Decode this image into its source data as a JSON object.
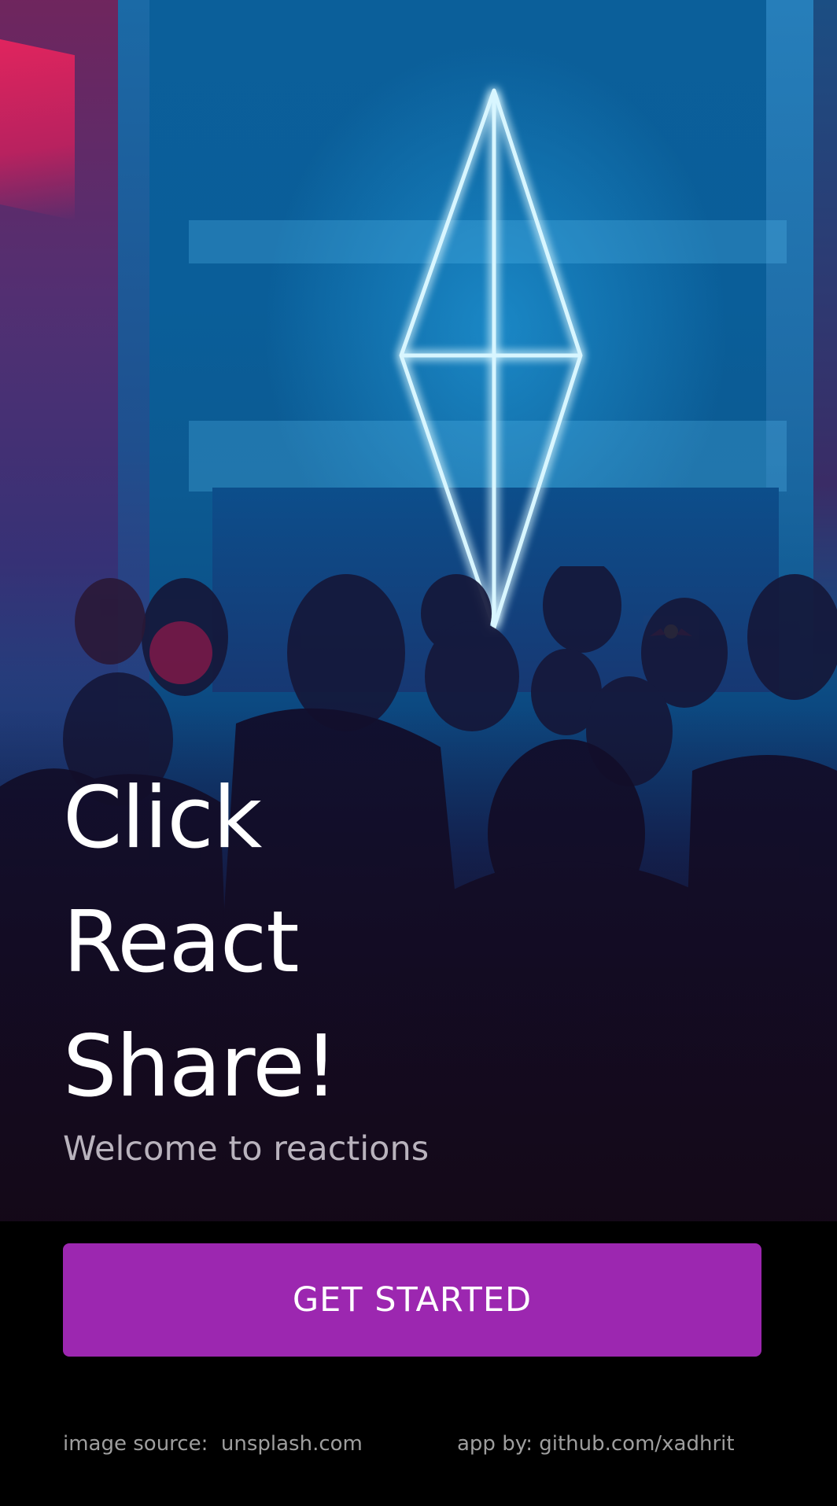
{
  "hero": {
    "headline_lines": [
      "Click",
      "React",
      "Share!"
    ],
    "subtitle": "Welcome to reactions"
  },
  "cta": {
    "label": "GET STARTED",
    "color": "#9c27b0"
  },
  "footer": {
    "image_source_label": "image source:",
    "image_source_link": "unsplash.com",
    "app_by_label": "app by:",
    "app_by_link": "github.com/xadhrit"
  },
  "colors": {
    "background": "#000000",
    "headline": "#ffffff",
    "subtitle": "#b9b3bd",
    "footer_text": "#9e9e9e",
    "neon": "#bfefff"
  }
}
